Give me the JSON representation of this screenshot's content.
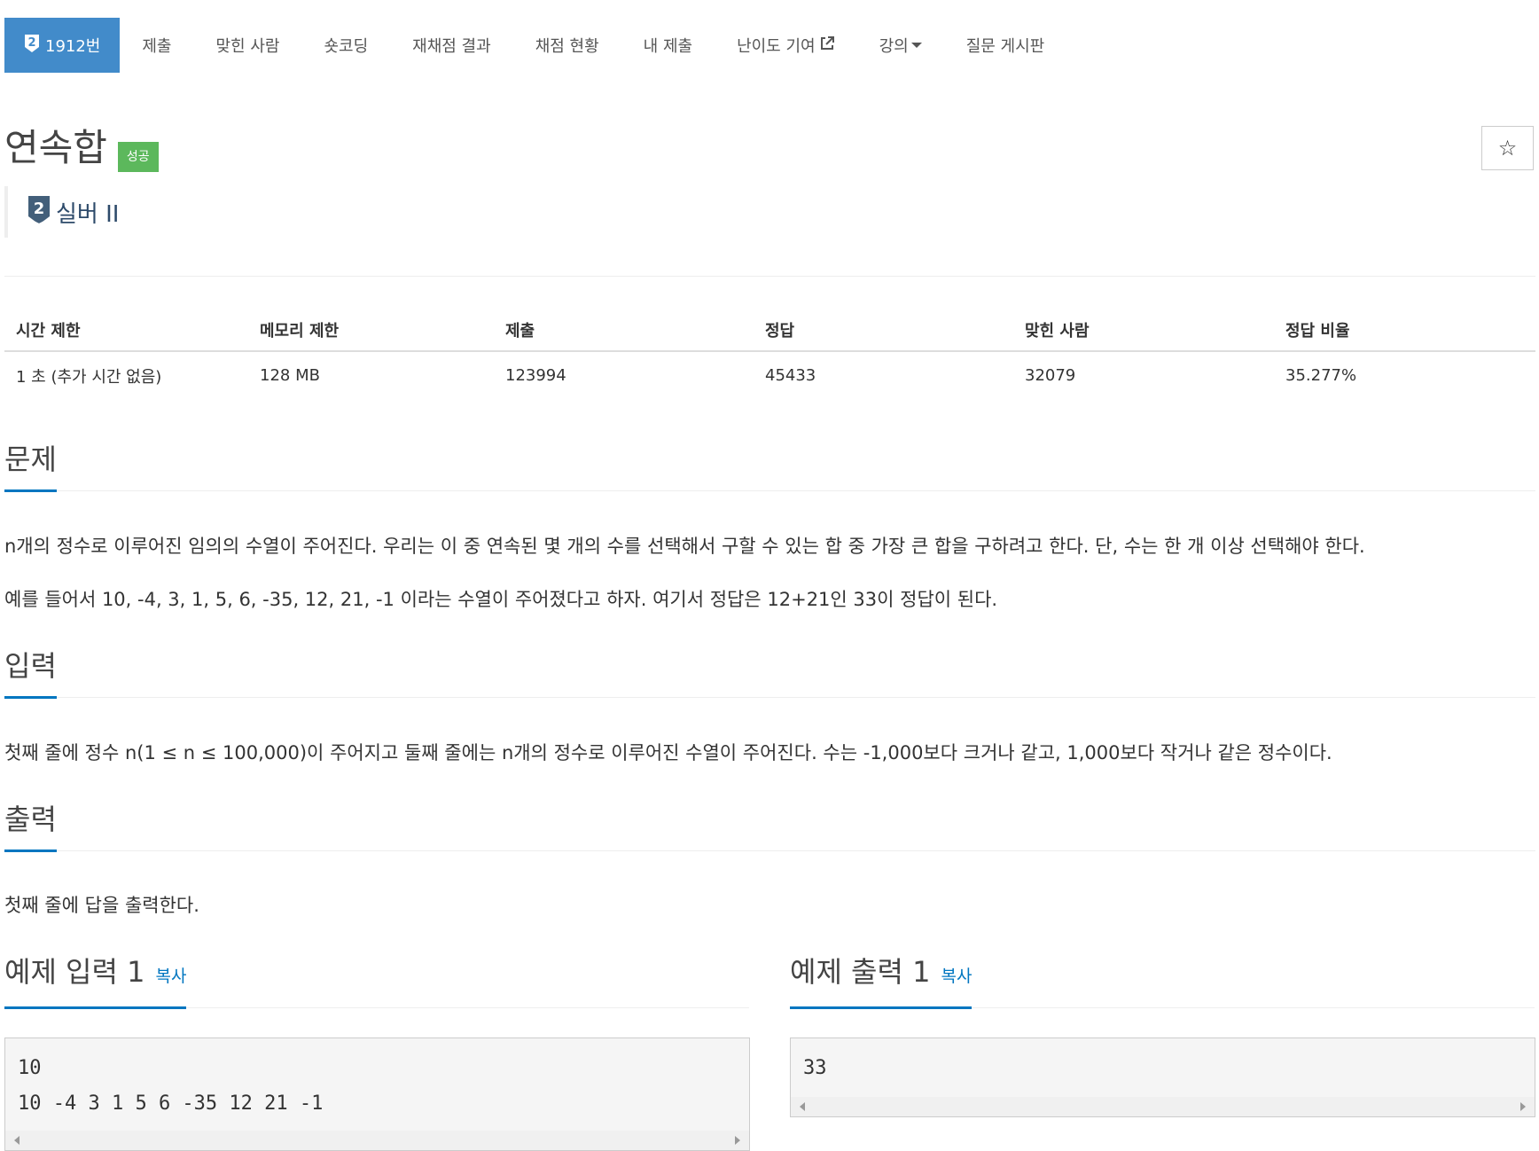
{
  "nav": {
    "problem_tab": "1912번",
    "items": [
      "제출",
      "맞힌 사람",
      "숏코딩",
      "재채점 결과",
      "채점 현황",
      "내 제출",
      "난이도 기여",
      "강의",
      "질문 게시판"
    ]
  },
  "problem": {
    "title": "연속합",
    "badge": "성공",
    "level": "실버 II",
    "tier_number": "2",
    "star": "☆"
  },
  "info_table": {
    "headers": [
      "시간 제한",
      "메모리 제한",
      "제출",
      "정답",
      "맞힌 사람",
      "정답 비율"
    ],
    "values": [
      "1 초 (추가 시간 없음)",
      "128 MB",
      "123994",
      "45433",
      "32079",
      "35.277%"
    ]
  },
  "sections": {
    "problem_head": "문제",
    "problem_text_1": "n개의 정수로 이루어진 임의의 수열이 주어진다. 우리는 이 중 연속된 몇 개의 수를 선택해서 구할 수 있는 합 중 가장 큰 합을 구하려고 한다. 단, 수는 한 개 이상 선택해야 한다.",
    "problem_text_2": "예를 들어서 10, -4, 3, 1, 5, 6, -35, 12, 21, -1 이라는 수열이 주어졌다고 하자. 여기서 정답은 12+21인 33이 정답이 된다.",
    "input_head": "입력",
    "input_text": "첫째 줄에 정수 n(1 ≤ n ≤ 100,000)이 주어지고 둘째 줄에는 n개의 정수로 이루어진 수열이 주어진다. 수는 -1,000보다 크거나 같고, 1,000보다 작거나 같은 정수이다.",
    "output_head": "출력",
    "output_text": "첫째 줄에 답을 출력한다."
  },
  "examples": {
    "input_head": "예제 입력 1",
    "output_head": "예제 출력 1",
    "copy": "복사",
    "input_body": "10\n10 -4 3 1 5 6 -35 12 21 -1",
    "output_body": "33"
  },
  "colors": {
    "accent": "#428bca",
    "link": "#0076c0",
    "success": "#5cb85c",
    "tier_silver": "#435f7a"
  }
}
